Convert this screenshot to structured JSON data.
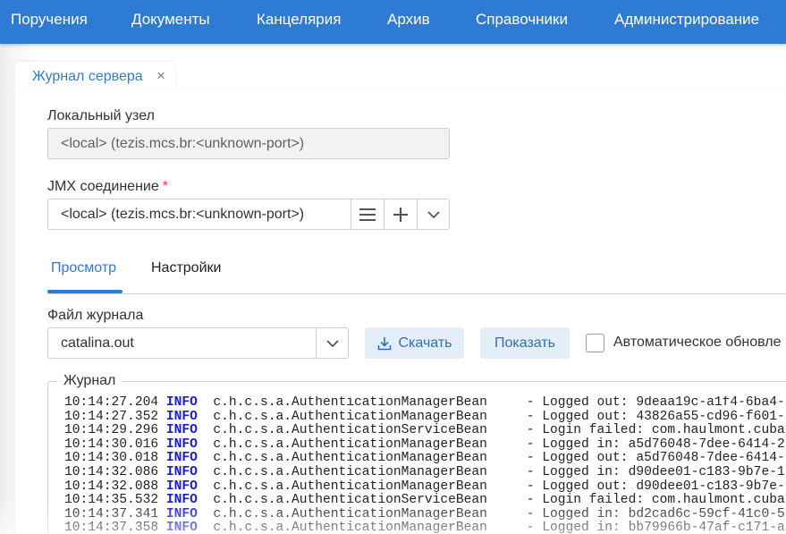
{
  "top_menu": {
    "items": [
      "Поручения",
      "Документы",
      "Канцелярия",
      "Архив",
      "Справочники",
      "Администрирование"
    ]
  },
  "tab": {
    "label": "Журнал сервера",
    "close_icon": "×"
  },
  "local_node": {
    "label": "Локальный узел",
    "value": "<local> (tezis.mcs.br:<unknown-port>)"
  },
  "jmx": {
    "label": "JMX соединение",
    "required_mark": "*",
    "value": "<local> (tezis.mcs.br:<unknown-port>)",
    "icons": [
      "list-icon",
      "plus-icon",
      "chevron-down-icon"
    ]
  },
  "subtabs": {
    "view": "Просмотр",
    "settings": "Настройки"
  },
  "log_file": {
    "label": "Файл журнала",
    "value": "catalina.out",
    "download_label": "Скачать",
    "show_label": "Показать",
    "auto_update_label": "Автоматическое обновле"
  },
  "log": {
    "title": "Журнал",
    "lines": [
      {
        "time": "10:14:27.204",
        "level": "INFO",
        "text": "  c.h.c.s.a.AuthenticationManagerBean     - Logged out: 9deaa19c-a1f4-6ba4-"
      },
      {
        "time": "10:14:27.352",
        "level": "INFO",
        "text": "  c.h.c.s.a.AuthenticationManagerBean     - Logged out: 43826a55-cd96-f601-"
      },
      {
        "time": "10:14:29.296",
        "level": "INFO",
        "text": "  c.h.c.s.a.AuthenticationServiceBean     - Login failed: com.haulmont.cuba"
      },
      {
        "time": "10:14:30.016",
        "level": "INFO",
        "text": "  c.h.c.s.a.AuthenticationManagerBean     - Logged in: a5d76048-7dee-6414-2"
      },
      {
        "time": "10:14:30.018",
        "level": "INFO",
        "text": "  c.h.c.s.a.AuthenticationManagerBean     - Logged out: a5d76048-7dee-6414-"
      },
      {
        "time": "10:14:32.086",
        "level": "INFO",
        "text": "  c.h.c.s.a.AuthenticationManagerBean     - Logged in: d90dee01-c183-9b7e-1"
      },
      {
        "time": "10:14:32.088",
        "level": "INFO",
        "text": "  c.h.c.s.a.AuthenticationManagerBean     - Logged out: d90dee01-c183-9b7e-"
      },
      {
        "time": "10:14:35.532",
        "level": "INFO",
        "text": "  c.h.c.s.a.AuthenticationServiceBean     - Login failed: com.haulmont.cuba"
      },
      {
        "time": "10:14:37.341",
        "level": "INFO",
        "text": "  c.h.c.s.a.AuthenticationManagerBean     - Logged in: bd2cad6c-59cf-41c0-5"
      },
      {
        "time": "10:14:37.358",
        "level": "INFO",
        "text": "  c.h.c.s.a.AuthenticationManagerBean     - Logged in: bb79966b-47af-c171-a"
      }
    ]
  },
  "colors": {
    "accent": "#2e7bd6",
    "log_level": "#1a1ad4",
    "required": "#e53935"
  }
}
